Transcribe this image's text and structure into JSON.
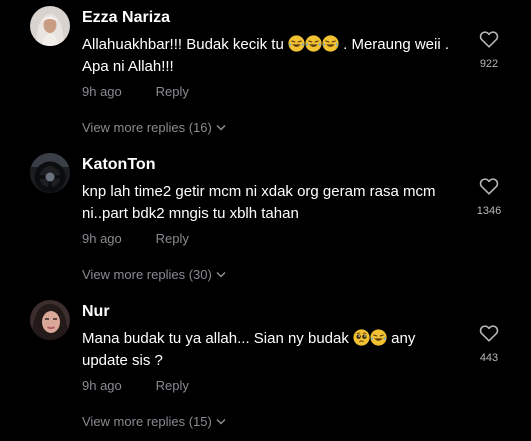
{
  "comments": [
    {
      "username": "Ezza Nariza",
      "text_parts": [
        "Allahuakhbar!!! Budak kecik tu ",
        " . Meraung weii . Apa ni Allah!!!"
      ],
      "emojis": [
        "crying-laughing-emoji",
        "crying-laughing-emoji",
        "crying-laughing-emoji"
      ],
      "timestamp": "9h ago",
      "reply_label": "Reply",
      "likes": "922",
      "view_replies": "View more replies (16)",
      "avatar": "woman-hijab-avatar"
    },
    {
      "username": "KatonTon",
      "text_parts": [
        "knp lah time2 getir mcm ni xdak org geram rasa mcm ni..part bdk2 mngis tu xblh tahan"
      ],
      "timestamp": "9h ago",
      "reply_label": "Reply",
      "likes": "1346",
      "view_replies": "View more replies (30)",
      "avatar": "steering-wheel-avatar"
    },
    {
      "username": "Nur",
      "text_parts": [
        "Mana budak tu ya allah... Sian ny budak ",
        " any update sis ?"
      ],
      "emojis": [
        "pleading-face-emoji",
        "crying-laughing-emoji"
      ],
      "timestamp": "9h ago",
      "reply_label": "Reply",
      "likes": "443",
      "view_replies": "View more replies (15)",
      "avatar": "woman-selfie-avatar"
    }
  ],
  "colors": {
    "background": "#000000",
    "username": "#ffffff",
    "comment_text": "#ffffff",
    "meta_text": "#8a8b91",
    "like_count": "#b7b8bc"
  }
}
